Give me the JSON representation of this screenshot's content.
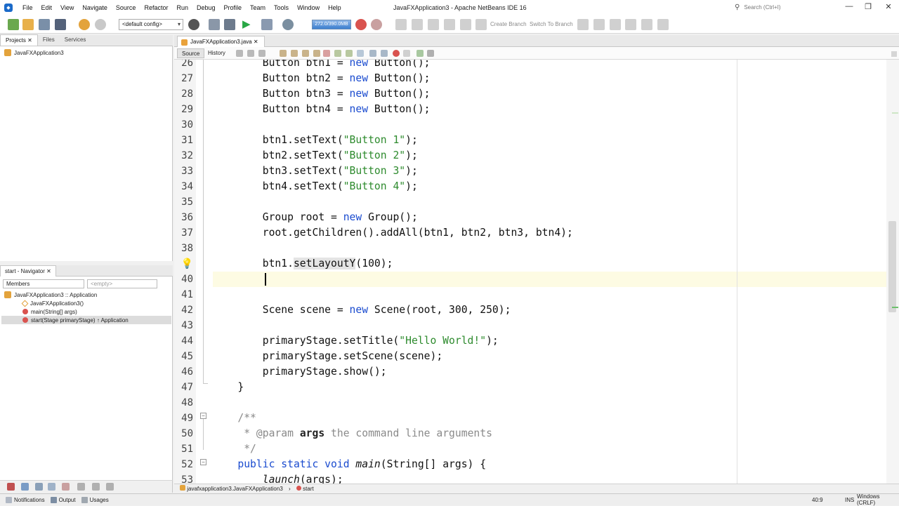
{
  "window": {
    "title": "JavaFXApplication3 - Apache NetBeans IDE 16",
    "search_placeholder": "Search (Ctrl+I)"
  },
  "menu": [
    "File",
    "Edit",
    "View",
    "Navigate",
    "Source",
    "Refactor",
    "Run",
    "Debug",
    "Profile",
    "Team",
    "Tools",
    "Window",
    "Help"
  ],
  "toolbar": {
    "config": "<default config>",
    "memory": "272.0/390.0MB",
    "create_branch": "Create Branch",
    "switch_branch": "Switch To Branch"
  },
  "left_tabs": [
    "Projects",
    "Files",
    "Services"
  ],
  "project_tree": {
    "root": "JavaFXApplication3"
  },
  "navigator": {
    "title": "start - Navigator",
    "members_select": "Members",
    "filter_select": "<empty>",
    "items": [
      "JavaFXApplication3 :: Application",
      "JavaFXApplication3()",
      "main(String[] args)",
      "start(Stage primaryStage) ↑ Application"
    ]
  },
  "editor": {
    "file_tab": "JavaFXApplication3.java",
    "source_tab": "Source",
    "history_tab": "History",
    "line_numbers": [
      "26",
      "27",
      "28",
      "29",
      "30",
      "31",
      "32",
      "33",
      "34",
      "35",
      "36",
      "37",
      "38",
      "",
      "40",
      "41",
      "42",
      "43",
      "44",
      "45",
      "46",
      "47",
      "48",
      "49",
      "50",
      "51",
      "52",
      "53"
    ],
    "breadcrumb_class": "javafxapplication3.JavaFXApplication3",
    "breadcrumb_method": "start"
  },
  "status": {
    "notifications": "Notifications",
    "output": "Output",
    "usages": "Usages",
    "position": "40:9",
    "mode": "INS",
    "line_endings": "Windows (CRLF)"
  }
}
